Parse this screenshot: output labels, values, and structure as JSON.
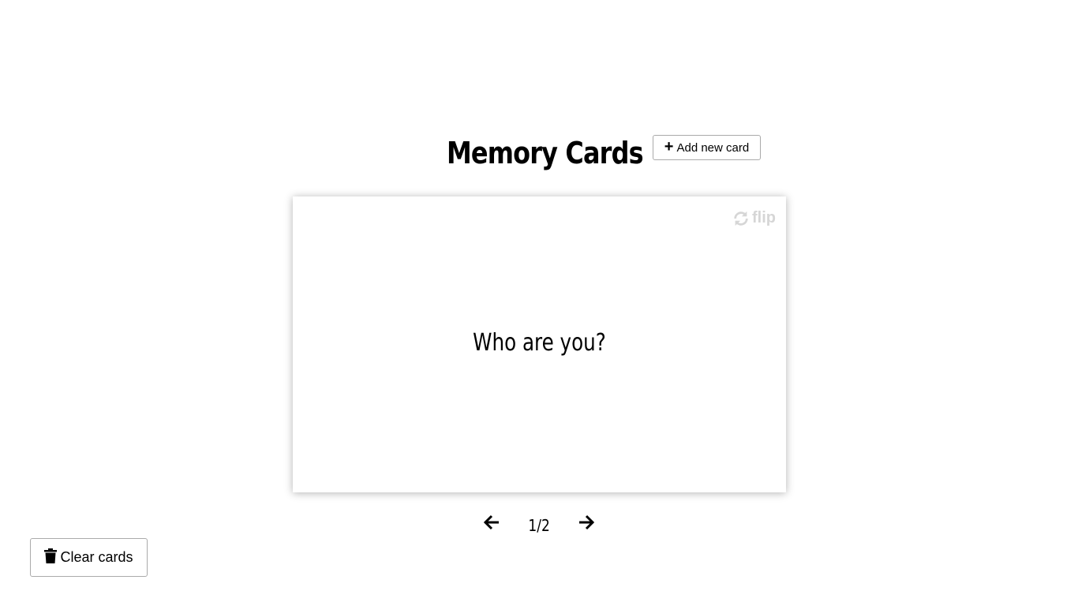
{
  "header": {
    "title": "Memory Cards",
    "add_button_label": "Add new card",
    "add_button_icon": "plus-icon"
  },
  "card": {
    "question": "Who are you?",
    "flip_label": "flip",
    "flip_icon": "sync-icon"
  },
  "navigation": {
    "prev_icon": "arrow-left-icon",
    "next_icon": "arrow-right-icon",
    "counter": "1/2"
  },
  "footer": {
    "clear_button_label": "Clear cards",
    "clear_button_icon": "trash-icon"
  },
  "colors": {
    "flip_hint": "#d6d6d6",
    "button_border": "#aaaaaa"
  }
}
